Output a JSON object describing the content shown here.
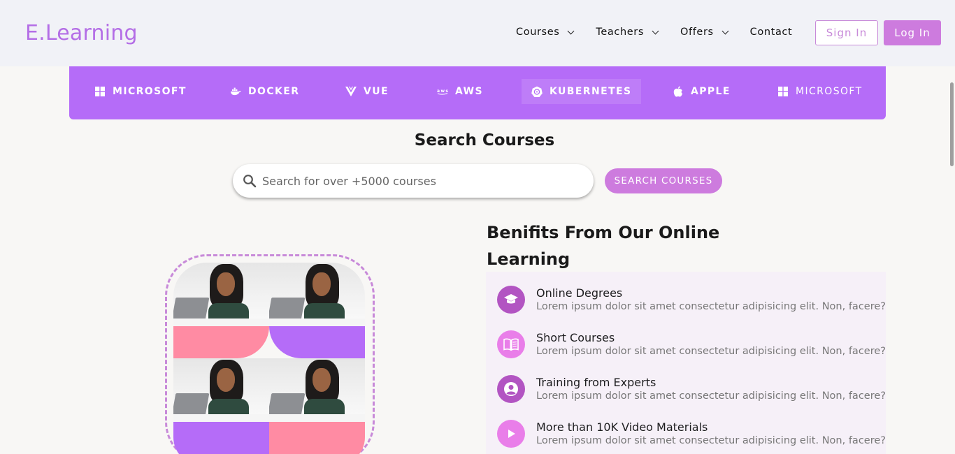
{
  "header": {
    "logo": "E.Learning",
    "nav": [
      {
        "label": "Courses",
        "has_dropdown": true
      },
      {
        "label": "Teachers",
        "has_dropdown": true
      },
      {
        "label": "Offers",
        "has_dropdown": true
      },
      {
        "label": "Contact",
        "has_dropdown": false
      }
    ],
    "signin_label": "Sign In",
    "login_label": "Log In"
  },
  "categories": [
    {
      "label": "MICROSOFT",
      "icon": "windows-icon"
    },
    {
      "label": "DOCKER",
      "icon": "docker-icon"
    },
    {
      "label": "VUE",
      "icon": "vue-icon"
    },
    {
      "label": "AWS",
      "icon": "aws-icon"
    },
    {
      "label": "KUBERNETES",
      "icon": "kubernetes-icon",
      "active": true
    },
    {
      "label": "APPLE",
      "icon": "apple-icon"
    },
    {
      "label": "MICROSOFT",
      "icon": "windows-icon"
    }
  ],
  "search": {
    "title": "Search Courses",
    "placeholder": "Search for over +5000 courses",
    "value": "",
    "button_label": "SEARCH COURSES"
  },
  "benefits": {
    "title": "Benifits From Our Online Learning",
    "items": [
      {
        "title": "Online Degrees",
        "desc": "Lorem ipsum dolor sit amet consectetur adipisicing elit. Non, facere?",
        "icon": "graduation-cap-icon"
      },
      {
        "title": "Short Courses",
        "desc": "Lorem ipsum dolor sit amet consectetur adipisicing elit. Non, facere?",
        "icon": "book-icon"
      },
      {
        "title": "Training from Experts",
        "desc": "Lorem ipsum dolor sit amet consectetur adipisicing elit. Non, facere?",
        "icon": "user-circle-icon"
      },
      {
        "title": "More than 10K Video Materials",
        "desc": "Lorem ipsum dolor sit amet consectetur adipisicing elit. Non, facere?",
        "icon": "play-icon"
      }
    ]
  },
  "colors": {
    "accent": "#cd7bde",
    "logo": "#b46ee6",
    "category_bar": "#b56cf8",
    "pink": "#ff8ba3"
  }
}
